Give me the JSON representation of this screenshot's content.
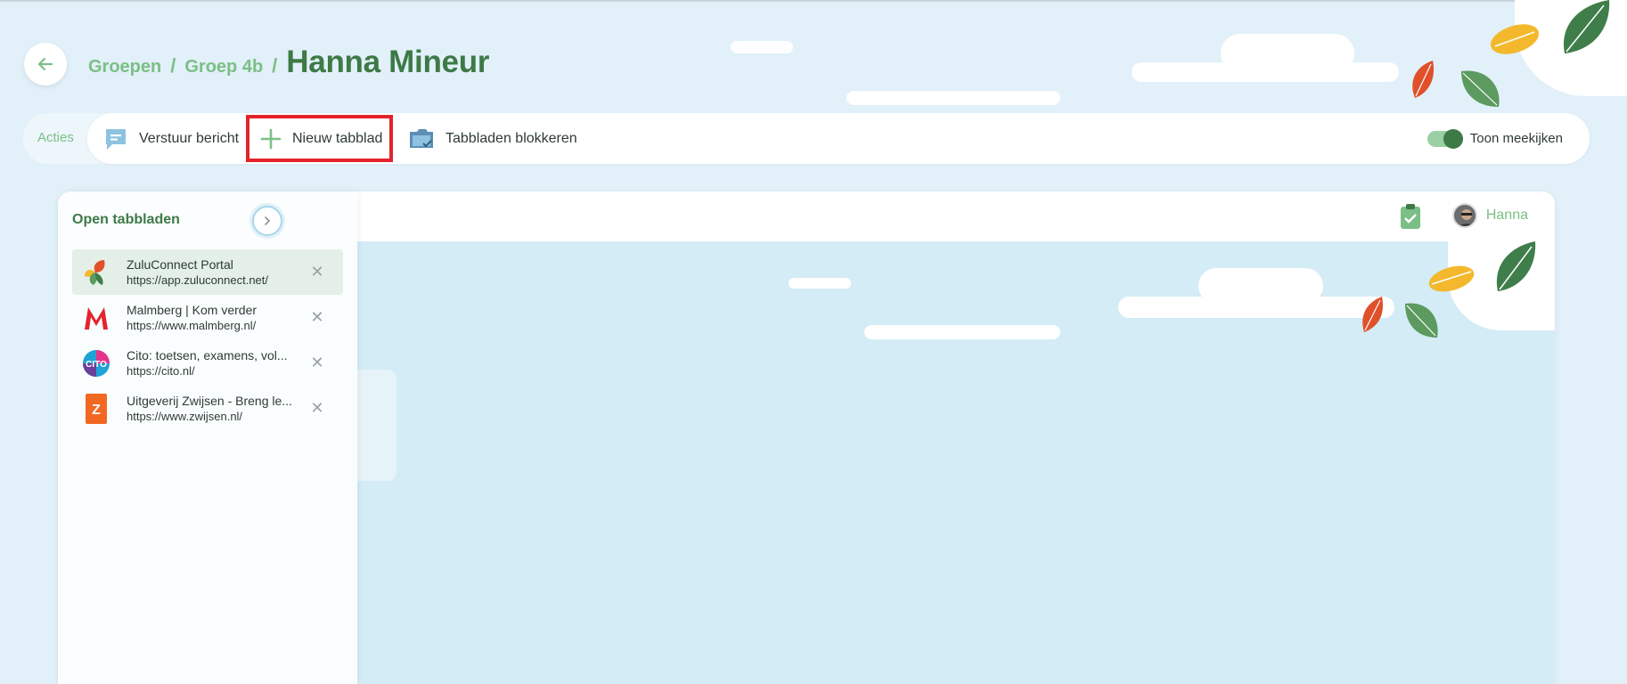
{
  "breadcrumb": {
    "items": [
      "Groepen",
      "Groep 4b"
    ],
    "separator": "/",
    "current": "Hanna Mineur"
  },
  "actions": {
    "label": "Acties",
    "send_message": "Verstuur bericht",
    "new_tab": "Nieuw tabblad",
    "block_tabs": "Tabbladen blokkeren",
    "toggle_label": "Toon meekijken",
    "toggle_on": true
  },
  "browser": {
    "user_name": "Hanna"
  },
  "panel": {
    "title": "Open tabbladen",
    "tabs": [
      {
        "title": "ZuluConnect Portal",
        "url": "https://app.zuluconnect.net/",
        "icon": "zuluconnect-leaf-icon",
        "active": true
      },
      {
        "title": "Malmberg | Kom verder",
        "url": "https://www.malmberg.nl/",
        "icon": "malmberg-m-icon",
        "active": false
      },
      {
        "title": "Cito: toetsen, examens, vol...",
        "url": "https://cito.nl/",
        "icon": "cito-logo-icon",
        "active": false
      },
      {
        "title": "Uitgeverij Zwijsen - Breng le...",
        "url": "https://www.zwijsen.nl/",
        "icon": "zwijsen-z-icon",
        "active": false
      }
    ]
  },
  "colors": {
    "brand_green": "#3d7a46",
    "light_green": "#7bbf86",
    "highlight_red": "#e4232c",
    "background": "#e2f0f9"
  }
}
